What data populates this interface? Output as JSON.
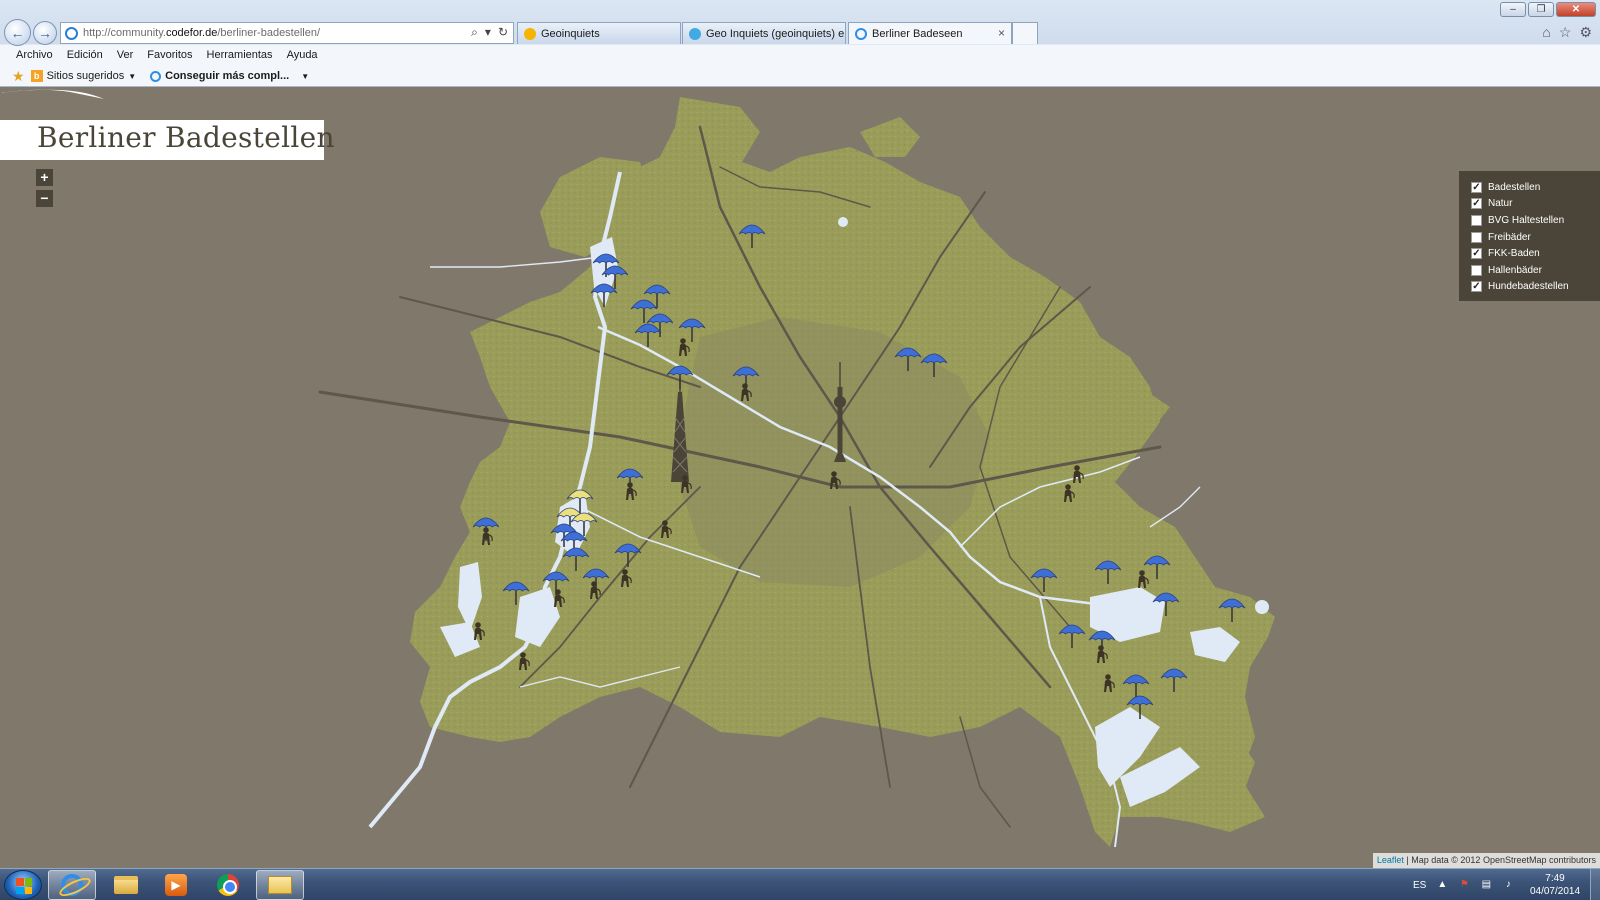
{
  "browser": {
    "url_prefix": "http://community.",
    "url_domain": "codefor.de",
    "url_path": "/berliner-badestellen/",
    "tabs": [
      {
        "title": "Geoinquiets",
        "icon_color": "#f5b400"
      },
      {
        "title": "Geo Inquiets (geoinquiets) en ...",
        "icon_color": "#41a9e4"
      },
      {
        "title": "Berliner Badeseen",
        "icon_color": "#2f8ee6"
      }
    ],
    "tab_close": "×",
    "menu": [
      "Archivo",
      "Edición",
      "Ver",
      "Favoritos",
      "Herramientas",
      "Ayuda"
    ],
    "favorites": {
      "suggested": "Sitios sugeridos",
      "more": "Conseguir más compl..."
    }
  },
  "map": {
    "title": "Berliner Badestellen",
    "zoom_in": "+",
    "zoom_out": "−",
    "colors": {
      "background": "#80786a",
      "green_areas": "#9a9c5a",
      "water": "#dfeaf6",
      "panel": "#4a4538",
      "umbrella_blue": "#3e6fd6",
      "umbrella_yellow": "#ece07c"
    },
    "layers": [
      {
        "label": "Badestellen",
        "checked": true
      },
      {
        "label": "Natur",
        "checked": true
      },
      {
        "label": "BVG Haltestellen",
        "checked": false
      },
      {
        "label": "Freibäder",
        "checked": false
      },
      {
        "label": "FKK-Baden",
        "checked": true
      },
      {
        "label": "Hallenbäder",
        "checked": false
      },
      {
        "label": "Hundebadestellen",
        "checked": true
      }
    ],
    "attribution": {
      "link": "Leaflet",
      "text": " | Map data © 2012 OpenStreetMap contributors"
    },
    "landmark_icons": [
      "radio-tower-icon",
      "tv-tower-icon"
    ],
    "marker_icons": [
      "umbrella-blue-icon",
      "umbrella-yellow-icon",
      "dog-icon"
    ]
  },
  "taskbar": {
    "language": "ES",
    "time": "7:49",
    "date": "04/07/2014"
  }
}
